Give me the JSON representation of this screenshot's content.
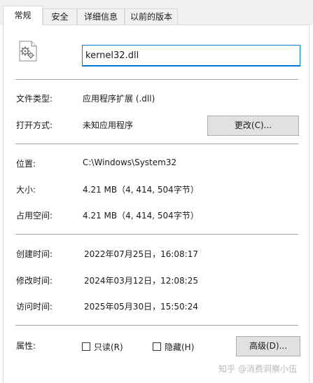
{
  "tabs": [
    {
      "label": "常规",
      "active": true
    },
    {
      "label": "安全",
      "active": false
    },
    {
      "label": "详细信息",
      "active": false
    },
    {
      "label": "以前的版本",
      "active": false
    }
  ],
  "file": {
    "name": "kernel32.dll",
    "icon": "dll-file-gear-icon"
  },
  "info": {
    "type_label": "文件类型:",
    "type_value": "应用程序扩展 (.dll)",
    "opens_with_label": "打开方式:",
    "opens_with_value": "未知应用程序",
    "change_button": "更改(C)...",
    "location_label": "位置:",
    "location_value": "C:\\Windows\\System32",
    "size_label": "大小:",
    "size_value": "4.21 MB（4, 414, 504字节）",
    "size_on_disk_label": "占用空间:",
    "size_on_disk_value": "4.21 MB（4, 414, 504字节）",
    "created_label": "创建时间:",
    "created_value": "2022年07月25日，16:08:17",
    "modified_label": "修改时间:",
    "modified_value": "2024年03月12日，12:08:25",
    "accessed_label": "访问时间:",
    "accessed_value": "2025年05月30日，15:50:24"
  },
  "attributes": {
    "label": "属性:",
    "readonly_label": "只读(R)",
    "readonly_checked": false,
    "hidden_label": "隐藏(H)",
    "hidden_checked": false,
    "advanced_button": "高级(D)..."
  },
  "watermark": "知乎 @消费洞察小伍",
  "colors": {
    "focus_border": "#0078d7",
    "button_face": "#e1e1e1",
    "tab_strip": "#f0f0f0"
  }
}
